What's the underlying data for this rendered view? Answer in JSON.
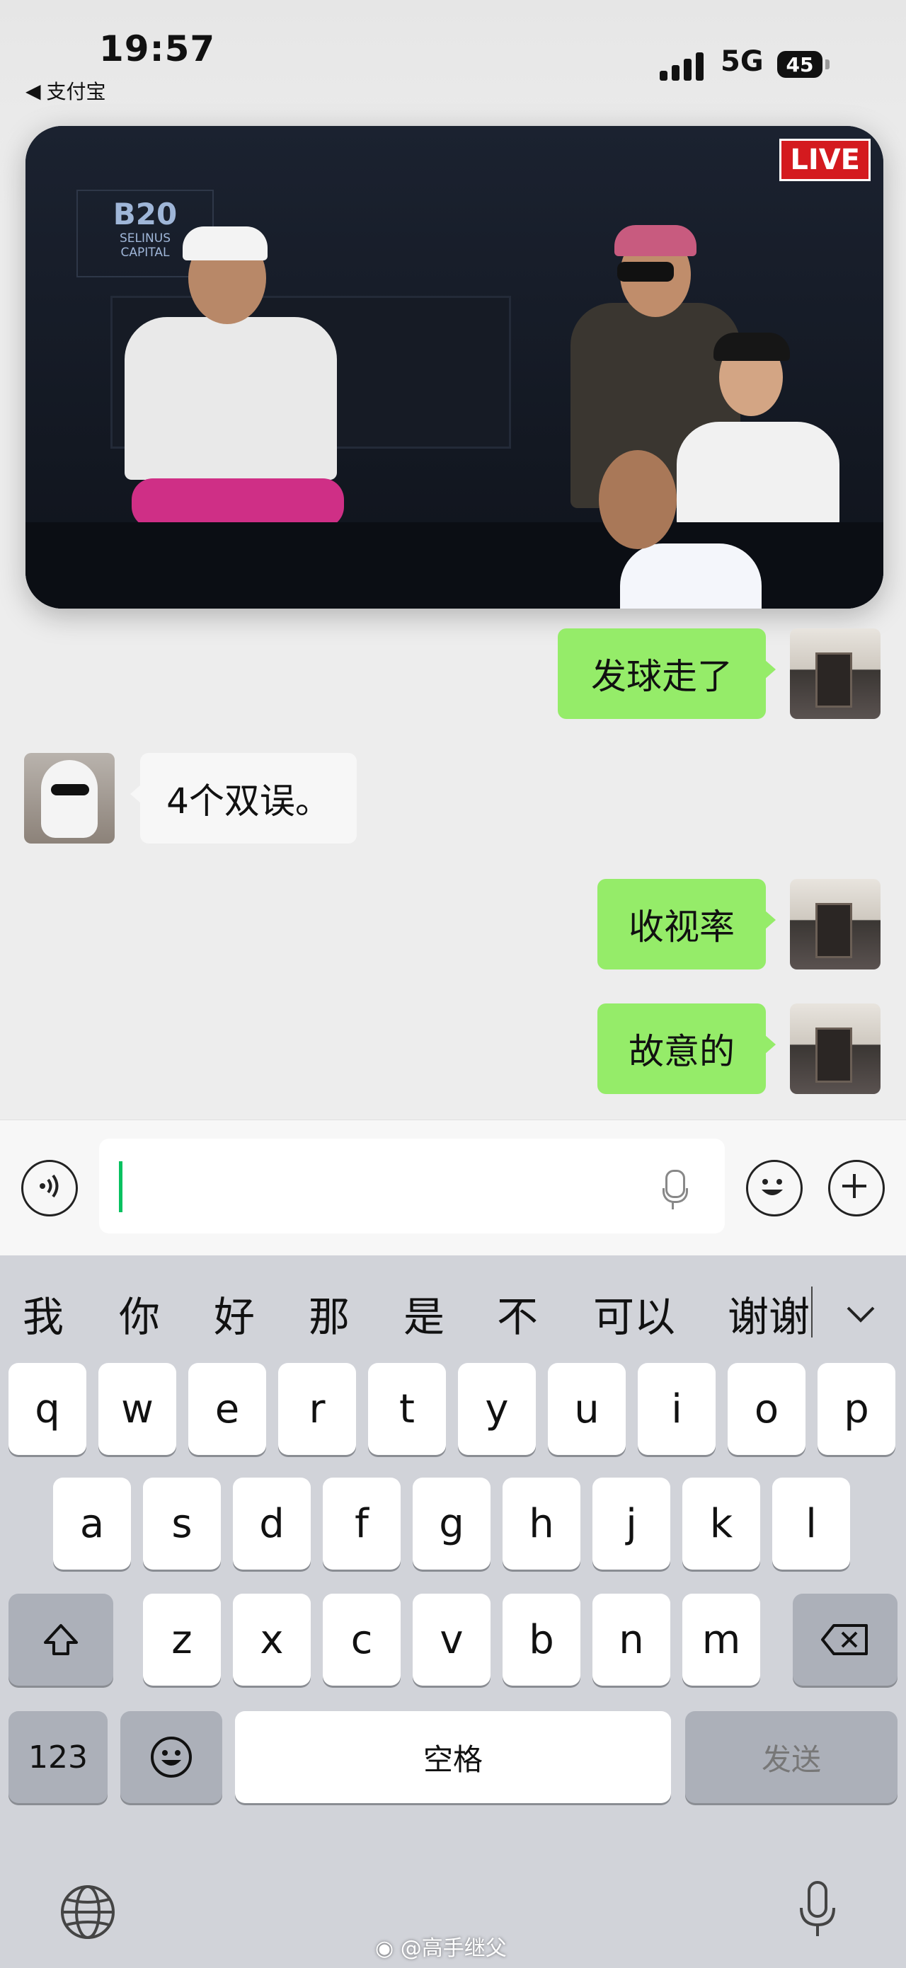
{
  "status_bar": {
    "time": "19:57",
    "back_app": "支付宝",
    "network": "5G",
    "battery": "45"
  },
  "video": {
    "sponsor_big": "B20",
    "sponsor_line1": "SELINUS",
    "sponsor_line2": "CAPITAL",
    "live_badge": "LIVE"
  },
  "messages": [
    {
      "side": "me",
      "text": "发球走了"
    },
    {
      "side": "other",
      "text": "4个双误。"
    },
    {
      "side": "me",
      "text": "收视率"
    },
    {
      "side": "me",
      "text": "故意的"
    }
  ],
  "input": {
    "value": ""
  },
  "candidates": [
    "我",
    "你",
    "好",
    "那",
    "是",
    "不",
    "可以",
    "谢谢"
  ],
  "keyboard": {
    "row1": [
      "q",
      "w",
      "e",
      "r",
      "t",
      "y",
      "u",
      "i",
      "o",
      "p"
    ],
    "row2": [
      "a",
      "s",
      "d",
      "f",
      "g",
      "h",
      "j",
      "k",
      "l"
    ],
    "row3": [
      "z",
      "x",
      "c",
      "v",
      "b",
      "n",
      "m"
    ],
    "numbers_label": "123",
    "space_label": "空格",
    "send_label": "发送"
  },
  "watermark": "@高手继父"
}
